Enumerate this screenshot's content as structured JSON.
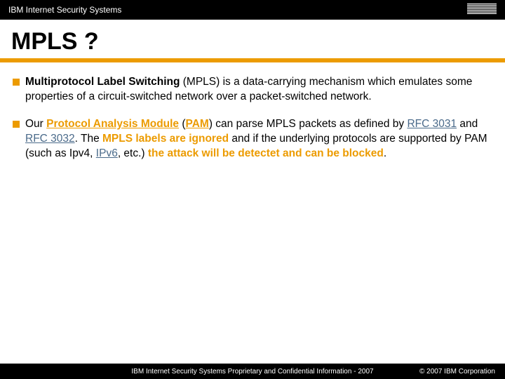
{
  "header": {
    "brand": "IBM Internet Security Systems",
    "logo_label": "IBM"
  },
  "title": "MPLS ?",
  "bullets": {
    "b1": {
      "strong": "Multiprotocol Label Switching",
      "after_strong": " (MPLS) is a data-carrying mechanism which emulates some properties of a circuit-switched network over a packet-switched network."
    },
    "b2": {
      "t1": "Our ",
      "pam_link": "Protocol Analysis Module",
      "t2": " (",
      "pam_short": "PAM",
      "t3": ") can parse MPLS packets as defined by ",
      "rfc3031": "RFC 3031",
      "t4": " and ",
      "rfc3032": "RFC 3032",
      "t5": ". The ",
      "mpls_ignored": "MPLS labels are ignored",
      "t6": " and if the underlying protocols are supported by PAM (such as Ipv4, ",
      "ipv6": "IPv6",
      "t7": ", etc.) ",
      "attack_block": "the attack will be detectet and can be blocked",
      "t8": "."
    }
  },
  "footer": {
    "center": "IBM Internet Security Systems Proprietary and Confidential Information - 2007",
    "right": "© 2007 IBM Corporation"
  }
}
